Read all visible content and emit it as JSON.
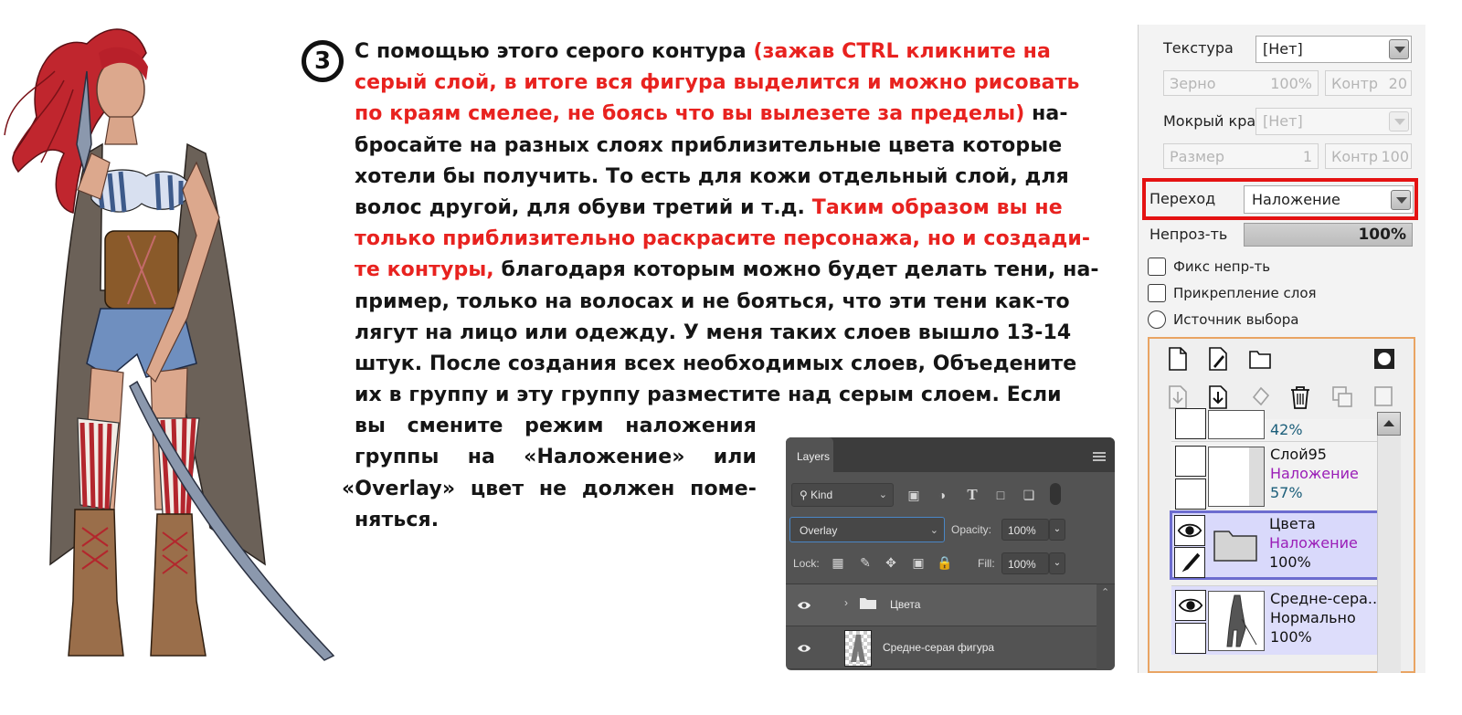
{
  "step_number": "3",
  "article_lines": [
    [
      {
        "t": "С помощью этого серого контура ",
        "c": ""
      },
      {
        "t": "(зажав CTRL кликните на",
        "c": "red"
      }
    ],
    [
      {
        "t": "серый слой, в итоге вся фигура выделится и можно рисовать",
        "c": "red"
      }
    ],
    [
      {
        "t": "по краям смелее, не боясь что вы вылезете за пределы)",
        "c": "red"
      },
      {
        "t": " на-",
        "c": ""
      }
    ],
    [
      {
        "t": "бросайте на разных слоях приблизительные цвета которые",
        "c": ""
      }
    ],
    [
      {
        "t": "хотели бы получить. То есть для кожи отдельный слой, для",
        "c": ""
      }
    ],
    [
      {
        "t": "волос другой, для обуви третий и т.д. ",
        "c": ""
      },
      {
        "t": "Таким образом вы не",
        "c": "red"
      }
    ],
    [
      {
        "t": "только приблизительно раскрасите персонажа, но и создади-",
        "c": "red"
      }
    ],
    [
      {
        "t": "те контуры,",
        "c": "red"
      },
      {
        "t": " благодаря которым можно будет делать тени, на-",
        "c": ""
      }
    ],
    [
      {
        "t": "пример, только на волосах и не бояться, что эти тени как-то",
        "c": ""
      }
    ],
    [
      {
        "t": "лягут на лицо или одежду. У меня таких слоев вышло 13-14",
        "c": ""
      }
    ],
    [
      {
        "t": "штук. После создания всех необходимых слоев, Объедените",
        "c": ""
      }
    ],
    [
      {
        "t": "их в группу и эту группу разместите над серым слоем. Если",
        "c": ""
      }
    ]
  ],
  "article_tail": [
    "вы смените режим наложения",
    "группы на «Наложение» или",
    "«Overlay» цвет не должен поме-",
    "няться."
  ],
  "photoshop": {
    "tab": "Layers",
    "filter": "Kind",
    "blend_mode": "Overlay",
    "opacity_label": "Opacity:",
    "opacity_value": "100%",
    "lock_label": "Lock:",
    "fill_label": "Fill:",
    "fill_value": "100%",
    "layers": [
      {
        "name": "Цвета",
        "type": "group"
      },
      {
        "name": "Средне-серая фигура",
        "type": "layer"
      }
    ]
  },
  "sai": {
    "texture_label": "Текстура",
    "texture_value": "[Нет]",
    "grain_label": "Зерно",
    "grain_value": "100%",
    "contrast_label": "Контр",
    "contrast_value": "20",
    "wet_edge_label": "Мокрый край",
    "wet_edge_value": "[Нет]",
    "size_label": "Размер",
    "size_value": "1",
    "contrast2_label": "Контр",
    "contrast2_value": "100",
    "blend_label": "Переход",
    "blend_value": "Наложение",
    "opacity_label": "Непроз-ть",
    "opacity_value": "100%",
    "checkboxes": [
      "Фикс непр-ть",
      "Прикрепление слоя",
      "Источник выбора"
    ],
    "top_partial_pct": "42%",
    "layers": [
      {
        "name": "Слой95",
        "mode": "Наложение",
        "opacity": "57%"
      },
      {
        "name": "Цвета",
        "mode": "Наложение",
        "opacity": "100%"
      },
      {
        "name": "Средне-сера...",
        "mode": "Нормально",
        "opacity": "100%"
      }
    ]
  },
  "colors": {
    "accent_red": "#e8221f",
    "highlight_red": "#e41212",
    "sai_mode_purple": "#9a1db7",
    "sai_selection": "#d9d9fb"
  }
}
